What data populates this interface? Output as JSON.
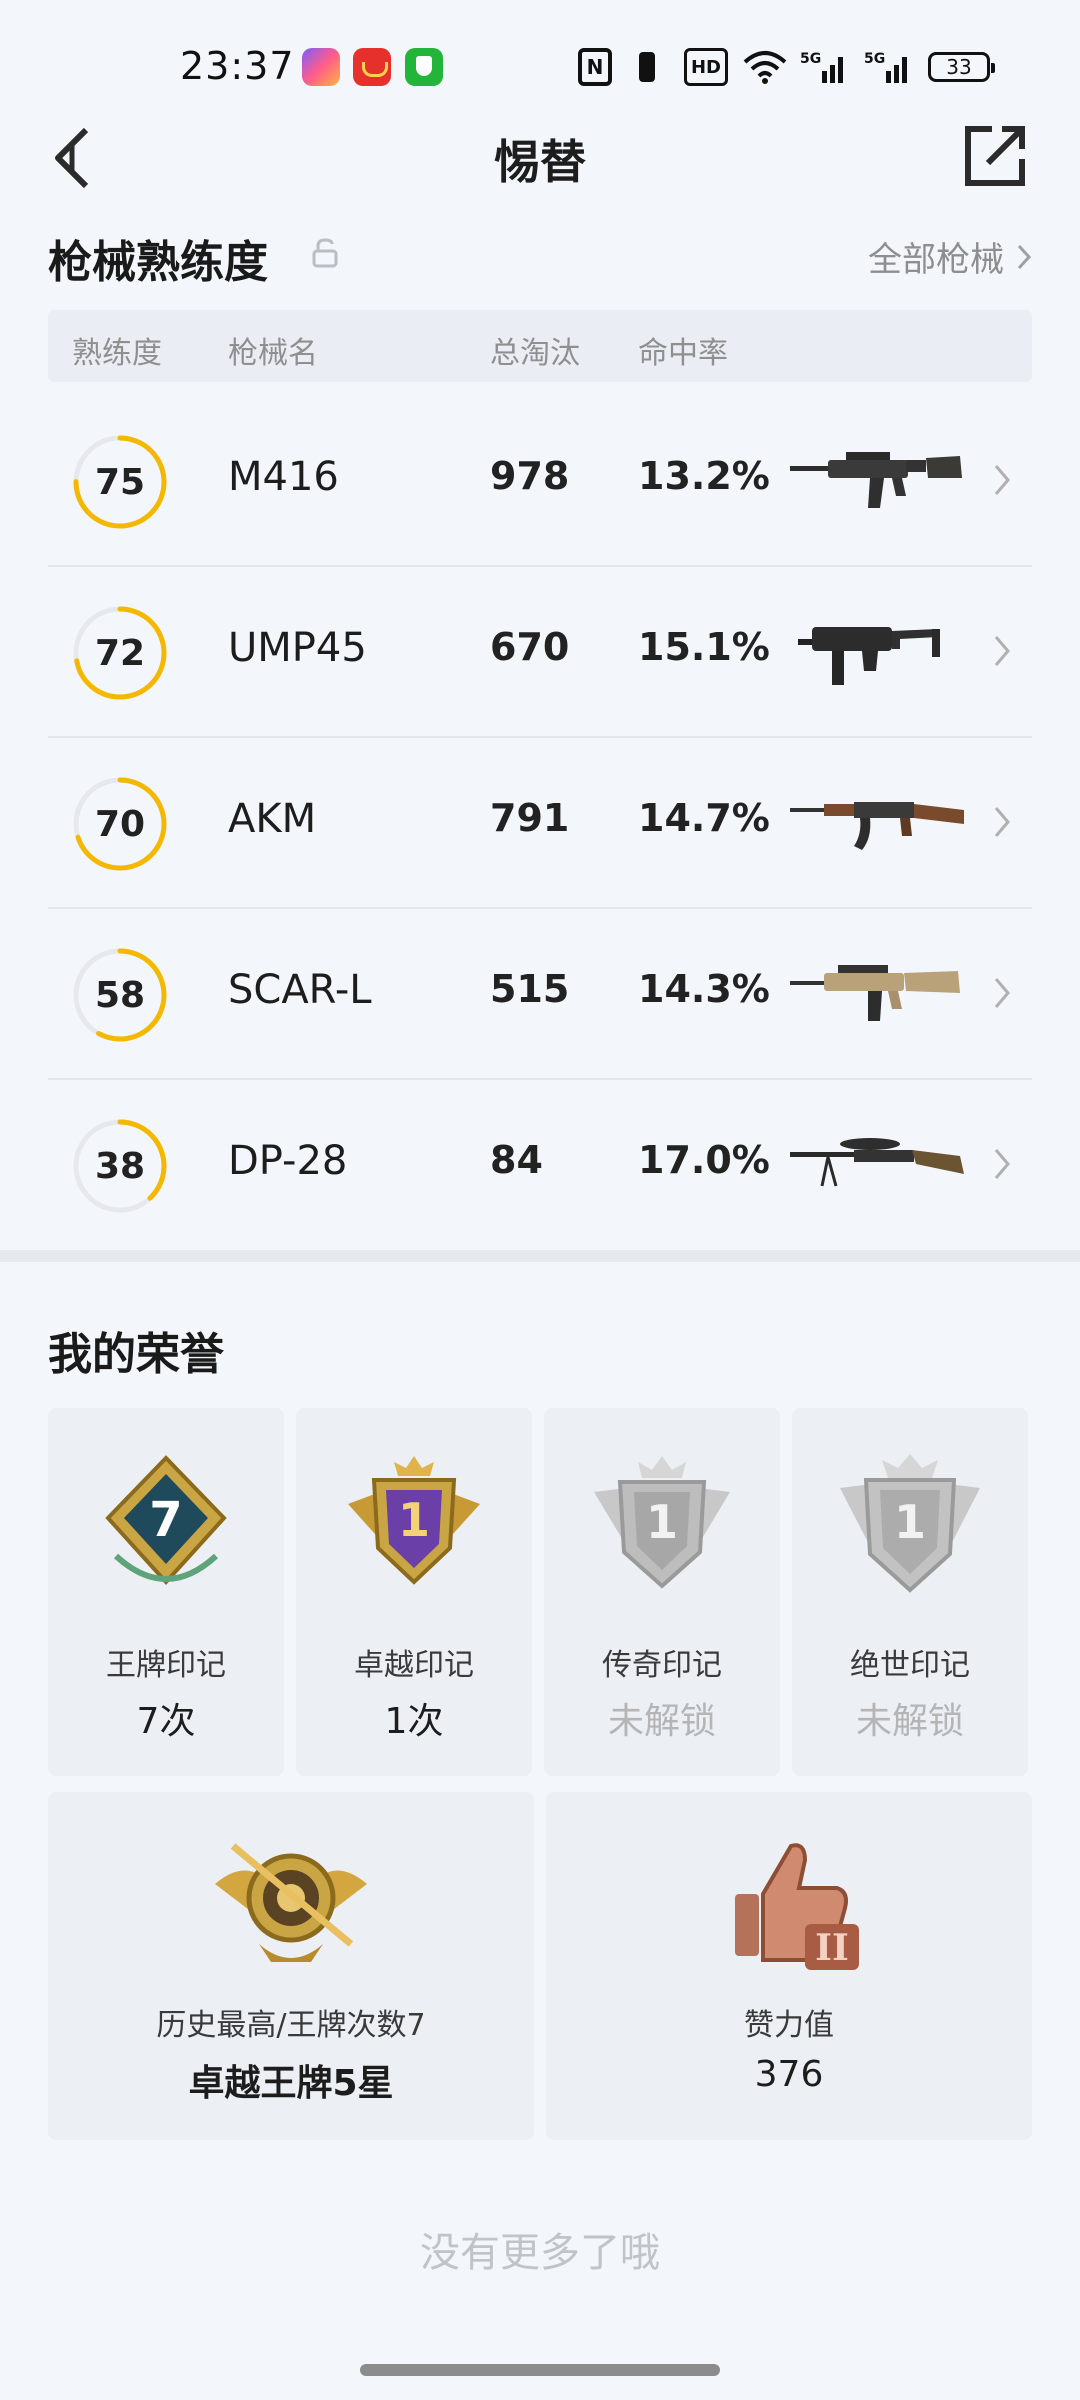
{
  "status_bar": {
    "time": "23:37",
    "hd_label": "HD",
    "battery": "33",
    "signal_label": "5G"
  },
  "nav": {
    "title": "惕替"
  },
  "weapons": {
    "section_title": "枪械熟练度",
    "all_label": "全部枪械",
    "columns": {
      "proficiency": "熟练度",
      "name": "枪械名",
      "kills": "总淘汰",
      "hit_rate": "命中率"
    },
    "rows": [
      {
        "proficiency": 75,
        "name": "M416",
        "kills": "978",
        "hit_rate": "13.2%",
        "image": "m416-rifle"
      },
      {
        "proficiency": 72,
        "name": "UMP45",
        "kills": "670",
        "hit_rate": "15.1%",
        "image": "ump45-smg"
      },
      {
        "proficiency": 70,
        "name": "AKM",
        "kills": "791",
        "hit_rate": "14.7%",
        "image": "akm-rifle"
      },
      {
        "proficiency": 58,
        "name": "SCAR-L",
        "kills": "515",
        "hit_rate": "14.3%",
        "image": "scarl-rifle"
      },
      {
        "proficiency": 38,
        "name": "DP-28",
        "kills": "84",
        "hit_rate": "17.0%",
        "image": "dp28-lmg"
      }
    ]
  },
  "honor": {
    "section_title": "我的荣誉",
    "cards": [
      {
        "label": "王牌印记",
        "value": "7次",
        "badge_text": "7",
        "locked": false
      },
      {
        "label": "卓越印记",
        "value": "1次",
        "badge_text": "1",
        "locked": false
      },
      {
        "label": "传奇印记",
        "value": "未解锁",
        "badge_text": "1",
        "locked": true
      },
      {
        "label": "绝世印记",
        "value": "未解锁",
        "badge_text": "1",
        "locked": true
      }
    ],
    "wide": [
      {
        "label": "历史最高/王牌次数7",
        "value": "卓越王牌5星",
        "icon": "rank-emblem-icon"
      },
      {
        "label": "赞力值",
        "value": "376",
        "icon": "thumbs-up-icon",
        "badge_text": "II"
      }
    ]
  },
  "footer": {
    "no_more": "没有更多了哦"
  },
  "colors": {
    "accent": "#f5b800",
    "ring_track": "#e6e8ec",
    "background": "#f3f6fb"
  }
}
